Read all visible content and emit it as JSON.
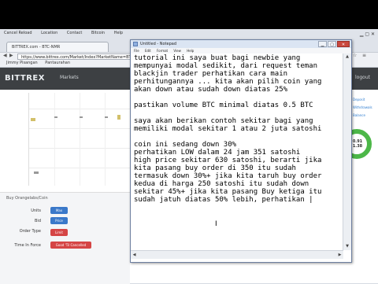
{
  "browser": {
    "tab_title": "BITTREX.com - BTC-NMR",
    "menus": [
      "Cancel Reload",
      "Location",
      "Contact",
      "Bitcoin",
      "Help"
    ],
    "address": "https://www.bittrex.com/Market/Index?MarketName=BTC-NMR",
    "bookmarks": [
      "Jimmy Pisangan",
      "Pantaurahan"
    ]
  },
  "site": {
    "logo": "BITTREX",
    "markets_label": "Markets",
    "logout_label": "logout",
    "order_panel_title": "Buy Orangelabs/Coin",
    "order_labels": [
      "Units",
      "Bid",
      "Order Type",
      "Time In Force"
    ],
    "order_buttons": {
      "max": "Max",
      "price": "Price",
      "type": "Limit",
      "tif": "Good 'Til Cancelled"
    },
    "right_links": [
      "Deposit",
      "Withdrawals",
      "Balance"
    ],
    "donut_value": "0.91\n1.38"
  },
  "notepad": {
    "title": "Untitled - Notepad",
    "menus": [
      "File",
      "Edit",
      "Format",
      "View",
      "Help"
    ],
    "text": "tutorial ini saya buat bagi newbie yang\nmempunyai modal sedikit, dari request teman\nblackjin trader perhatikan cara main\nperhitungannya ... kita akan pilih coin yang\nakan down atau sudah down diatas 25%\n\npastikan volume BTC minimal diatas 0.5 BTC\n\nsaya akan berikan contoh sekitar bagi yang\nmemiliki modal sekitar 1 atau 2 juta satoshi\n\ncoin ini sedang down 30%\nperhatikan LOW dalam 24 jam 351 satoshi\nhigh price sekitar 630 satoshi, berarti jika\nkita pasang buy order di 350 itu sudah\ntermasuk down 30%+ jika kita taruh buy order\nkedua di harga 250 satoshi itu sudah down\nsekitar 45%+ jika kita pasang Buy ketiga itu\nsudah jatuh diatas 50% lebih, perhatikan |"
  }
}
